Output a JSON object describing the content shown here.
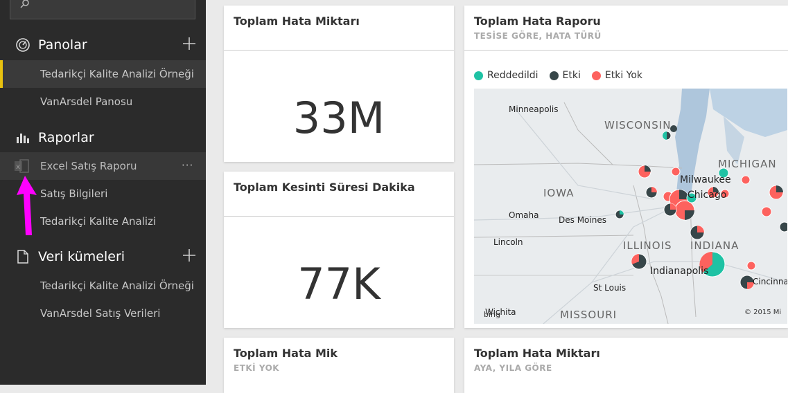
{
  "sidebar": {
    "sections": {
      "dashboards": {
        "title": "Panolar",
        "icon": "dashboard-icon"
      },
      "reports": {
        "title": "Raporlar",
        "icon": "report-icon"
      },
      "datasets": {
        "title": "Veri kümeleri",
        "icon": "dataset-icon"
      }
    },
    "dashboards": [
      {
        "label": "Tedarikçi Kalite Analizi Örneği",
        "active": true
      },
      {
        "label": "VanArsdel Panosu"
      }
    ],
    "reports": [
      {
        "label": "Excel Satış Raporu",
        "more": "···"
      },
      {
        "label": "Satış Bilgileri"
      },
      {
        "label": "Tedarikçi Kalite Analizi"
      }
    ],
    "datasets": [
      {
        "label": "Tedarikçi Kalite Analizi Örneği"
      },
      {
        "label": "VanArsdel Satış Verileri"
      }
    ]
  },
  "tiles": {
    "t1": {
      "title": "Toplam Hata Miktarı",
      "value": "33M"
    },
    "t2": {
      "title": "Toplam Kesinti Süresi Dakika",
      "value": "77K"
    },
    "t3": {
      "title": "Toplam Hata Raporu",
      "subtitle": "TESİSE GÖRE, HATA TÜRÜ",
      "legend": [
        {
          "label": "Reddedildi",
          "color": "#1ec2a4"
        },
        {
          "label": "Etki",
          "color": "#374649"
        },
        {
          "label": "Etki Yok",
          "color": "#fd625e"
        }
      ],
      "map": {
        "states": {
          "wisconsin": "WISCONSIN",
          "michigan": "MICHIGAN",
          "iowa": "IOWA",
          "illinois": "ILLINOIS",
          "indiana": "INDIANA",
          "missouri": "MISSOURI"
        },
        "cities": {
          "minneapolis": "Minneapolis",
          "milwaukee": "Milwaukee",
          "chicago": "Chicago",
          "omaha": "Omaha",
          "desmoines": "Des Moines",
          "lincoln": "Lincoln",
          "indianapolis": "Indianapolis",
          "stlouis": "St Louis",
          "cincinnati": "Cincinna",
          "wichita": "Wichita"
        },
        "bing": "bing",
        "copyright": "© 2015 Mi"
      }
    },
    "t4": {
      "title": "Toplam Hata Mik",
      "subtitle": "ETKİ YOK"
    },
    "t5": {
      "title": "Toplam Hata Miktarı",
      "subtitle": "AYA, YILA GÖRE"
    }
  }
}
